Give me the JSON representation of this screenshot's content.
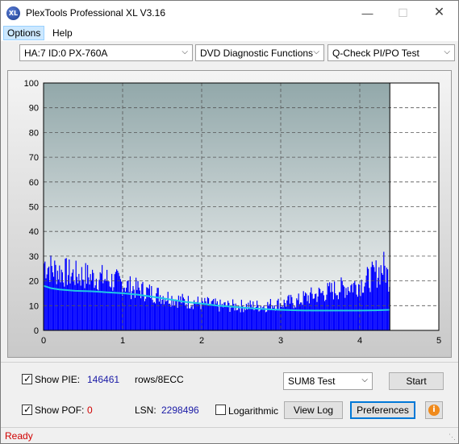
{
  "window": {
    "title": "PlexTools Professional XL V3.16",
    "icon_label": "XL",
    "controls": {
      "minimize": "—",
      "maximize": "☐",
      "close": "✕"
    }
  },
  "menu": {
    "items": [
      "Options",
      "Help"
    ]
  },
  "toolbar": {
    "drive": "HA:7 ID:0  PX-760A",
    "function": "DVD Diagnostic Functions",
    "test": "Q-Check PI/PO Test"
  },
  "chart_data": {
    "type": "bar",
    "title": "",
    "xlabel": "",
    "ylabel": "",
    "xlim": [
      0,
      5
    ],
    "ylim": [
      0,
      100
    ],
    "x_ticks": [
      "0",
      "1",
      "2",
      "3",
      "4",
      "5"
    ],
    "y_ticks": [
      "0",
      "10",
      "20",
      "30",
      "40",
      "50",
      "60",
      "70",
      "80",
      "90",
      "100"
    ],
    "grid": true,
    "data_end_x": 4.38,
    "colors": {
      "bars": "#0000ff",
      "line": "#1fc8e6",
      "plot_bg_top": "#92a8aa",
      "plot_bg_bottom": "#f8f8f8"
    },
    "series": [
      {
        "type": "bar",
        "x": [
          0.0,
          0.1,
          0.2,
          0.3,
          0.4,
          0.5,
          0.6,
          0.7,
          0.8,
          0.9,
          1.0,
          1.1,
          1.2,
          1.3,
          1.4,
          1.5,
          1.6,
          1.7,
          1.8,
          1.9,
          2.0,
          2.1,
          2.2,
          2.3,
          2.4,
          2.5,
          2.6,
          2.7,
          2.8,
          2.9,
          3.0,
          3.1,
          3.2,
          3.3,
          3.4,
          3.5,
          3.6,
          3.7,
          3.8,
          3.9,
          4.0,
          4.1,
          4.2,
          4.3,
          4.38
        ],
        "values": [
          33,
          30,
          29,
          28,
          27,
          27,
          26,
          26,
          25,
          24,
          23,
          21,
          20,
          19,
          18,
          17,
          16,
          15,
          14,
          14,
          13,
          13,
          12,
          12,
          12,
          12,
          12,
          12,
          12,
          13,
          13,
          14,
          14,
          16,
          17,
          18,
          19,
          20,
          21,
          22,
          23,
          25,
          28,
          31,
          24
        ]
      },
      {
        "type": "line",
        "x": [
          0.0,
          0.1,
          0.2,
          0.4,
          0.6,
          0.8,
          1.0,
          1.2,
          1.4,
          1.6,
          1.8,
          2.0,
          2.2,
          2.4,
          2.6,
          2.8,
          3.0,
          3.2,
          3.4,
          3.6,
          3.8,
          4.0,
          4.2,
          4.38
        ],
        "values": [
          18,
          17,
          16.5,
          16,
          15.8,
          15.4,
          15,
          14.4,
          13.5,
          12.5,
          11.5,
          10.8,
          10,
          9.5,
          9,
          8.6,
          8.3,
          8.1,
          8,
          8,
          8,
          8,
          8.1,
          8.3
        ]
      }
    ]
  },
  "controls": {
    "show_pie_label": "Show PIE:",
    "pie_value": "146461",
    "rows_label": "rows/8ECC",
    "show_pof_label": "Show POF:",
    "pof_value": "0",
    "lsn_label": "LSN:",
    "lsn_value": "2298496",
    "logarithmic_label": "Logarithmic",
    "sum_select": "SUM8 Test",
    "start_label": "Start",
    "view_log_label": "View Log",
    "preferences_label": "Preferences",
    "info_icon": "i",
    "show_pie_checked": true,
    "show_pof_checked": true,
    "logarithmic_checked": false
  },
  "status": {
    "text": "Ready"
  }
}
